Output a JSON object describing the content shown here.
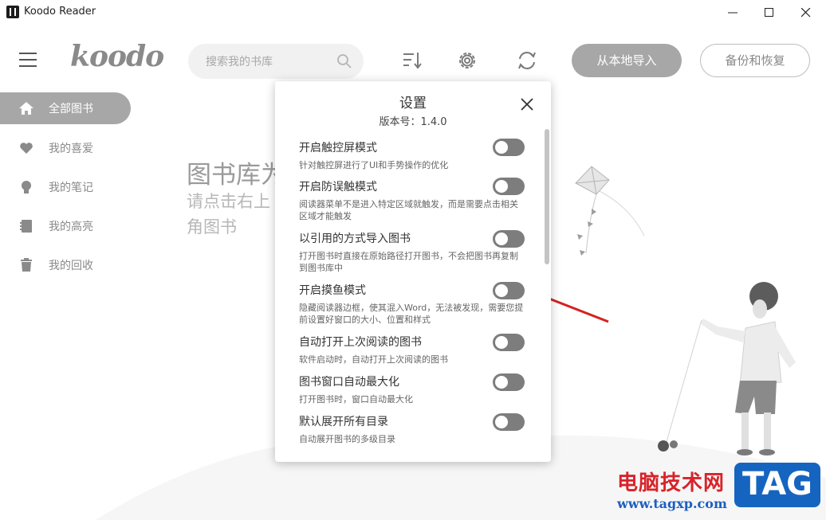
{
  "window": {
    "title": "Koodo Reader"
  },
  "header": {
    "logo": "koodo",
    "search_placeholder": "搜索我的书库",
    "import_label": "从本地导入",
    "backup_label": "备份和恢复"
  },
  "sidebar": {
    "items": [
      {
        "label": "全部图书",
        "icon": "home-icon",
        "active": true
      },
      {
        "label": "我的喜爱",
        "icon": "heart-icon",
        "active": false
      },
      {
        "label": "我的笔记",
        "icon": "bulb-icon",
        "active": false
      },
      {
        "label": "我的高亮",
        "icon": "notebook-icon",
        "active": false
      },
      {
        "label": "我的回收",
        "icon": "trash-icon",
        "active": false
      }
    ]
  },
  "empty_state": {
    "title": "图书库为",
    "subtitle": "请点击右上角图书"
  },
  "settings": {
    "title": "设置",
    "version": "版本号：1.4.0",
    "items": [
      {
        "title": "开启触控屏模式",
        "desc": "针对触控屏进行了UI和手势操作的优化",
        "enabled": false
      },
      {
        "title": "开启防误触模式",
        "desc": "阅读器菜单不是进入特定区域就触发，而是需要点击相关区域才能触发",
        "enabled": false
      },
      {
        "title": "以引用的方式导入图书",
        "desc": "打开图书时直接在原始路径打开图书，不会把图书再复制到图书库中",
        "enabled": false
      },
      {
        "title": "开启摸鱼模式",
        "desc": "隐藏阅读器边框，使其混入Word，无法被发现，需要您提前设置好窗口的大小、位置和样式",
        "enabled": false
      },
      {
        "title": "自动打开上次阅读的图书",
        "desc": "软件启动时，自动打开上次阅读的图书",
        "enabled": false
      },
      {
        "title": "图书窗口自动最大化",
        "desc": "打开图书时，窗口自动最大化",
        "enabled": false
      },
      {
        "title": "默认展开所有目录",
        "desc": "自动展开图书的多级目录",
        "enabled": false
      }
    ]
  },
  "watermark": {
    "site_name": "电脑技术网",
    "url": "www.tagxp.com",
    "tag": "TAG"
  },
  "colors": {
    "accent_gray": "#a7a7a7",
    "toggle_off": "#7d7d7d",
    "annotation_arrow": "#d62222"
  }
}
